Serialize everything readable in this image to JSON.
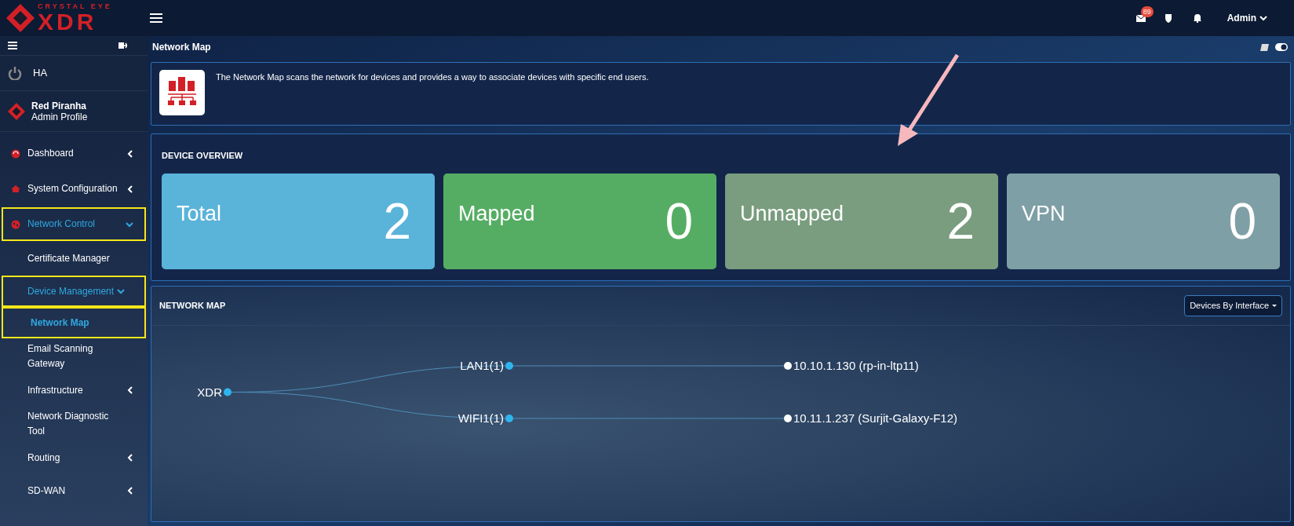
{
  "logo": {
    "tagline": "CRYSTAL EYE",
    "name": "XDR"
  },
  "topbar": {
    "mail_count": "89",
    "user": "Admin"
  },
  "sidebar": {
    "ha_label": "HA",
    "profile": {
      "name": "Red Piranha",
      "role": "Admin Profile"
    },
    "items": [
      {
        "label": "Dashboard",
        "expanded": false,
        "selected": false,
        "highlighted": false
      },
      {
        "label": "System Configuration",
        "expanded": false,
        "selected": false,
        "highlighted": false
      },
      {
        "label": "Network Control",
        "expanded": true,
        "selected": true,
        "highlighted": true,
        "children": [
          {
            "label": "Certificate Manager",
            "selected": false,
            "highlighted": false
          },
          {
            "label": "Device Management",
            "expanded": true,
            "selected": true,
            "highlighted": true,
            "children": [
              {
                "label": "Network Map",
                "selected": true,
                "highlighted": true
              }
            ]
          },
          {
            "label": "Email Scanning Gateway",
            "selected": false,
            "highlighted": false
          },
          {
            "label": "Infrastructure",
            "expanded": false,
            "selected": false,
            "highlighted": false
          },
          {
            "label": "Network Diagnostic Tool",
            "selected": false,
            "highlighted": false
          },
          {
            "label": "Routing",
            "expanded": false,
            "selected": false,
            "highlighted": false
          },
          {
            "label": "SD-WAN",
            "expanded": false,
            "selected": false,
            "highlighted": false
          }
        ]
      }
    ]
  },
  "page_title": "Network Map",
  "intro": "The Network Map scans the network for devices and provides a way to associate devices with specific end users.",
  "device_overview": {
    "title": "DEVICE OVERVIEW",
    "cards": [
      {
        "label": "Total",
        "value": "2",
        "color": "#5ab3d9"
      },
      {
        "label": "Mapped",
        "value": "0",
        "color": "#55ad64"
      },
      {
        "label": "Unmapped",
        "value": "2",
        "color": "#799d7e"
      },
      {
        "label": "VPN",
        "value": "0",
        "color": "#7e9fa5"
      }
    ]
  },
  "network_map": {
    "title": "NETWORK MAP",
    "view_button": "Devices By Interface",
    "tree": {
      "label": "XDR",
      "children": [
        {
          "label": "LAN1(1)",
          "children": [
            {
              "label": "10.10.1.130 (rp-in-ltp11)"
            }
          ]
        },
        {
          "label": "WIFI1(1)",
          "children": [
            {
              "label": "10.11.1.237 (Surjit-Galaxy-F12)"
            }
          ]
        }
      ]
    }
  },
  "annotation_arrow": true
}
